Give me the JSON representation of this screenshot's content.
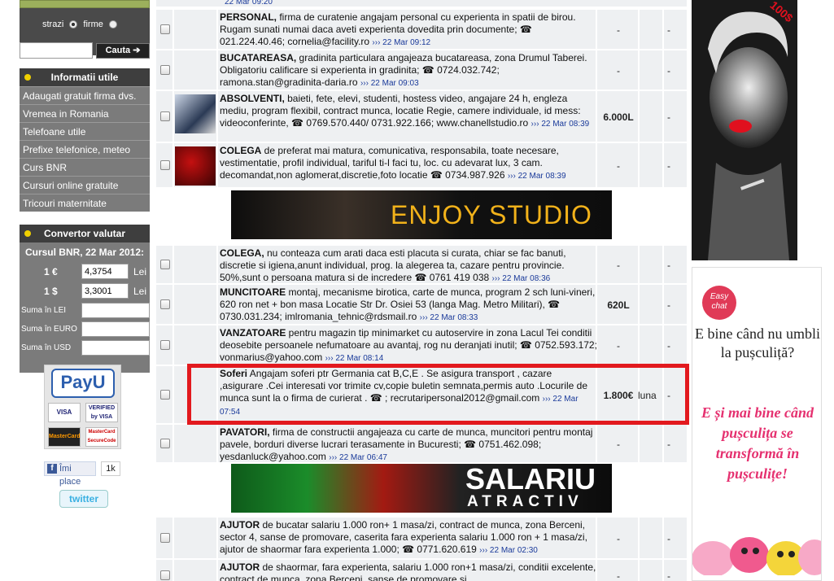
{
  "search": {
    "radio_streets": "strazi",
    "radio_companies": "firme",
    "button": "Cauta ➔",
    "input_value": ""
  },
  "info_panel": {
    "title": "Informatii utile",
    "items": [
      "Adaugati gratuit firma dvs.",
      "Vremea in Romania",
      "Telefoane utile",
      "Prefixe telefonice, meteo",
      "Curs BNR",
      "Cursuri online gratuite",
      "Tricouri maternitate"
    ]
  },
  "converter": {
    "title": "Convertor valutar",
    "subtitle": "Cursul BNR, 22 Mar 2012:",
    "rates": [
      {
        "symbol": "1 €",
        "value": "4,3754",
        "unit": "Lei"
      },
      {
        "symbol": "1 $",
        "value": "3,3001",
        "unit": "Lei"
      }
    ],
    "sums": [
      "Suma în LEI",
      "Suma în EURO",
      "Suma în USD"
    ]
  },
  "social": {
    "payu": "PayU",
    "cards": [
      "VISA",
      "VERIFIED by VISA",
      "MasterCard",
      "MasterCard SecureCode"
    ],
    "like": "Îmi place",
    "like_count": "1k",
    "twitter": "twitter"
  },
  "top_fragment": "22 Mar 09:20",
  "listings": [
    {
      "title": "PERSONAL,",
      "text": " firma de curatenie angajam personal cu experienta in spatii de birou. Rugam sunati numai daca aveti experienta dovedita prin documente; ☎ 021.224.40.46; cornelia@facility.ro",
      "meta": "›››  22 Mar 09:12",
      "price": "-",
      "period": "",
      "extra": "-"
    },
    {
      "title": "BUCATAREASA,",
      "text": " gradinita particulara angajeaza bucatareasa, zona Drumul Taberei. Obligatoriu calificare si experienta in gradinita; ☎ 0724.032.742; ramona.stan@gradinita-daria.ro",
      "meta": "›››  22 Mar 09:03",
      "price": "-",
      "period": "",
      "extra": "-"
    },
    {
      "title": "ABSOLVENTI,",
      "text": " baieti, fete, elevi, studenti, hostess video, angajare 24 h, engleza mediu, program flexibil, contract munca, locatie Regie, camere individuale, id mess: videoconferinte, ☎ 0769.570.440/ 0731.922.166; www.chanellstudio.ro",
      "meta": "›››  22 Mar 08:39",
      "price": "6.000L",
      "period": "",
      "extra": "-"
    },
    {
      "title": "COLEGA",
      "text": " de preferat mai matura, comunicativa, responsabila, toate necesare, vestimentatie, profil individual, tariful ti-l faci tu, loc. cu adevarat lux, 3 cam. decomandat,non aglomerat,discretie,foto locatie ☎ 0734.987.926",
      "meta": "›››  22 Mar 08:39",
      "price": "-",
      "period": "",
      "extra": "-"
    },
    {
      "title": "COLEGA,",
      "text": " nu conteaza cum arati daca esti placuta si curata, chiar se fac banuti, discretie si igiena,anunt individual, prog. la alegerea ta, cazare pentru provincie. 50%,sunt o persoana matura si de incredere ☎ 0761 419 038",
      "meta": "›››  22 Mar 08:36",
      "price": "-",
      "period": "",
      "extra": "-"
    },
    {
      "title": "MUNCITOARE",
      "text": " montaj, mecanisme birotica, carte de munca, program 2 sch luni-vineri, 620 ron net + bon masa Locatie Str Dr. Osiei 53 (langa Mag. Metro Militari), ☎ 0730.031.234; imlromania_tehnic@rdsmail.ro",
      "meta": "›››  22 Mar 08:33",
      "price": "620L",
      "period": "",
      "extra": "-"
    },
    {
      "title": "VANZATOARE",
      "text": " pentru magazin tip minimarket cu autoservire in zona Lacul Tei conditii deosebite persoanele nefumatoare au avantaj, rog nu deranjati inutil; ☎ 0752.593.172; vonmarius@yahoo.com",
      "meta": "›››  22 Mar 08:14",
      "price": "-",
      "period": "",
      "extra": "-"
    },
    {
      "title": "Soferi",
      "text": " Angajam soferi ptr Germania cat B,C,E . Se asigura transport , cazare ,asigurare .Cei interesati vor trimite cv,copie buletin semnata,permis auto .Locurile de munca sunt la o firma de curierat . ☎ ; recrutaripersonal2012@gmail.com",
      "meta": "›››  22 Mar 07:54",
      "price": "1.800€",
      "period": "luna",
      "extra": "-"
    },
    {
      "title": "PAVATORI,",
      "text": " firma de constructii angajeaza cu carte de munca, muncitori pentru montaj pavele, borduri diverse lucrari terasamente in Bucuresti; ☎ 0751.462.098; yesdanluck@yahoo.com",
      "meta": "›››  22 Mar 06:47",
      "price": "-",
      "period": "",
      "extra": "-"
    },
    {
      "title": "AJUTOR",
      "text": " de bucatar salariu 1.000 ron+ 1 masa/zi, contract de munca, zona Berceni, sector 4, sanse de promovare, caserita fara experienta salariu 1.000 ron + 1 masa/zi, ajutor de shaormar fara experienta 1.000; ☎ 0771.620.619",
      "meta": "›››  22 Mar 02:30",
      "price": "-",
      "period": "",
      "extra": "-"
    },
    {
      "title": "AJUTOR",
      "text": " de shaormar, fara experienta, salariu 1.000 ron+1 masa/zi, conditii excelente, contract de munca, zona Berceni, sanse de promovare si",
      "meta": "",
      "price": "-",
      "period": "",
      "extra": "-"
    }
  ],
  "banners": {
    "enjoy": "ENJOY STUDIO",
    "salariu_1": "SALARIU",
    "salariu_2": "ATRACTIV"
  },
  "ads": {
    "ad1_badge": "100$",
    "ad2_badge": "Easy chat",
    "ad2_question": "E bine când nu umbli la pușculiță?",
    "ad2_answer": "E și mai bine când pușculița se transformă în pușculițe!"
  }
}
